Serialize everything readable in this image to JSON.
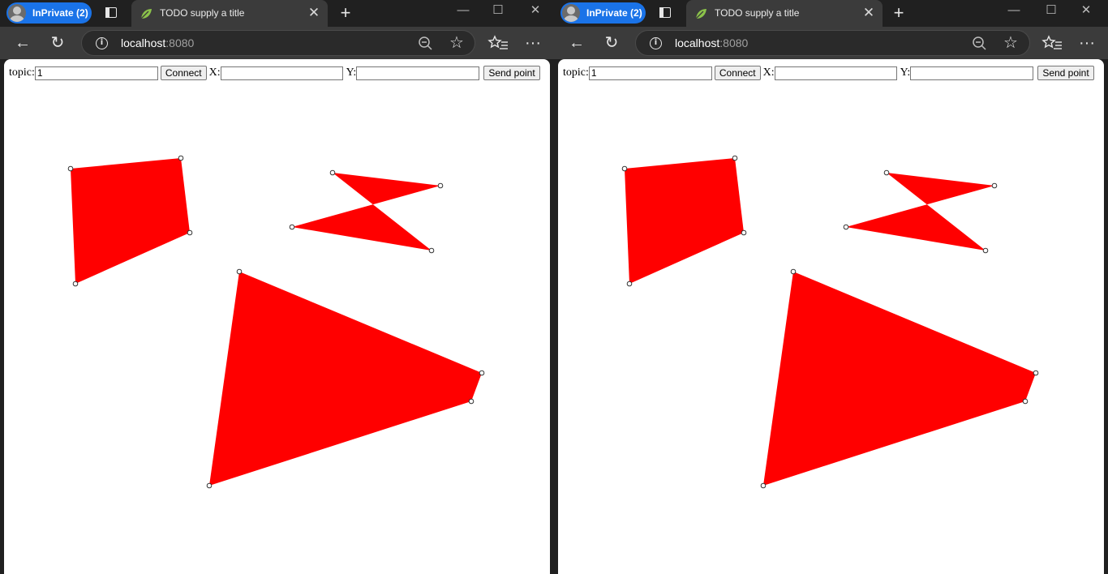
{
  "browser": {
    "profile_label": "InPrivate (2)",
    "tab_title": "TODO supply a title",
    "url_host": "localhost",
    "url_port": ":8080"
  },
  "form": {
    "topic_label": "topic:",
    "topic_value": "1",
    "connect_label": "Connect",
    "x_label": "X:",
    "x_value": "",
    "y_label": "Y:",
    "y_value": "",
    "send_label": "Send point"
  },
  "colors": {
    "polygon_fill": "#ff0000",
    "vertex_stroke": "#333333",
    "profile_accent": "#1a73e8"
  },
  "icons": [
    "user-avatar-icon",
    "tab-actions-icon",
    "leaf-favicon-icon",
    "close-icon",
    "plus-icon",
    "minimize-icon",
    "maximize-icon",
    "back-arrow-icon",
    "refresh-icon",
    "info-icon",
    "zoom-out-icon",
    "star-icon",
    "favorites-icon",
    "more-icon"
  ],
  "polygons": [
    {
      "points": [
        [
          82,
          135
        ],
        [
          218,
          122
        ],
        [
          229,
          214
        ],
        [
          88,
          277
        ]
      ]
    },
    {
      "points": [
        [
          405,
          140
        ],
        [
          538,
          156
        ],
        [
          355,
          207
        ],
        [
          527,
          236
        ]
      ]
    },
    {
      "points": [
        [
          290,
          262
        ],
        [
          589,
          387
        ],
        [
          576,
          422
        ],
        [
          253,
          526
        ]
      ]
    }
  ]
}
